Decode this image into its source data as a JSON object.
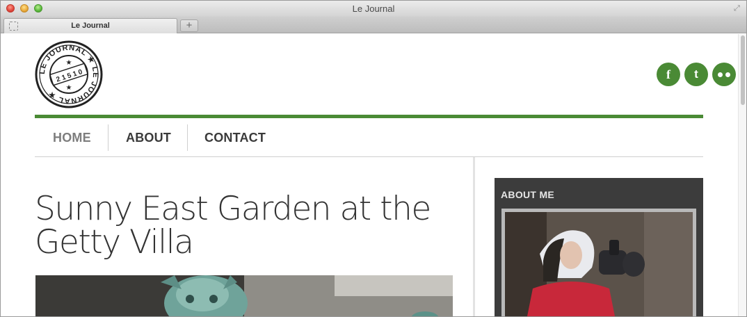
{
  "window": {
    "title": "Le Journal"
  },
  "tabs": [
    {
      "label": "Le Journal"
    }
  ],
  "new_tab_symbol": "+",
  "logo": {
    "ring_text": "LE JOURNAL · LE JOURNAL ·",
    "center_text": "2 1 5 1 0"
  },
  "social": [
    {
      "name": "facebook-icon",
      "glyph": "f"
    },
    {
      "name": "twitter-icon",
      "glyph": "t"
    },
    {
      "name": "flickr-icon",
      "glyph": ""
    }
  ],
  "nav": {
    "items": [
      {
        "label": "HOME",
        "active": true
      },
      {
        "label": "ABOUT",
        "active": false
      },
      {
        "label": "CONTACT",
        "active": false
      }
    ]
  },
  "post": {
    "title_line1": "Sunny East Garden at the",
    "title_line2": "Getty Villa"
  },
  "sidebar": {
    "title": "ABOUT ME"
  },
  "colors": {
    "accent": "#4a8a35",
    "sidebar_bg": "#3c3c3c",
    "text": "#333333",
    "nav_active": "#7d7d7d"
  }
}
